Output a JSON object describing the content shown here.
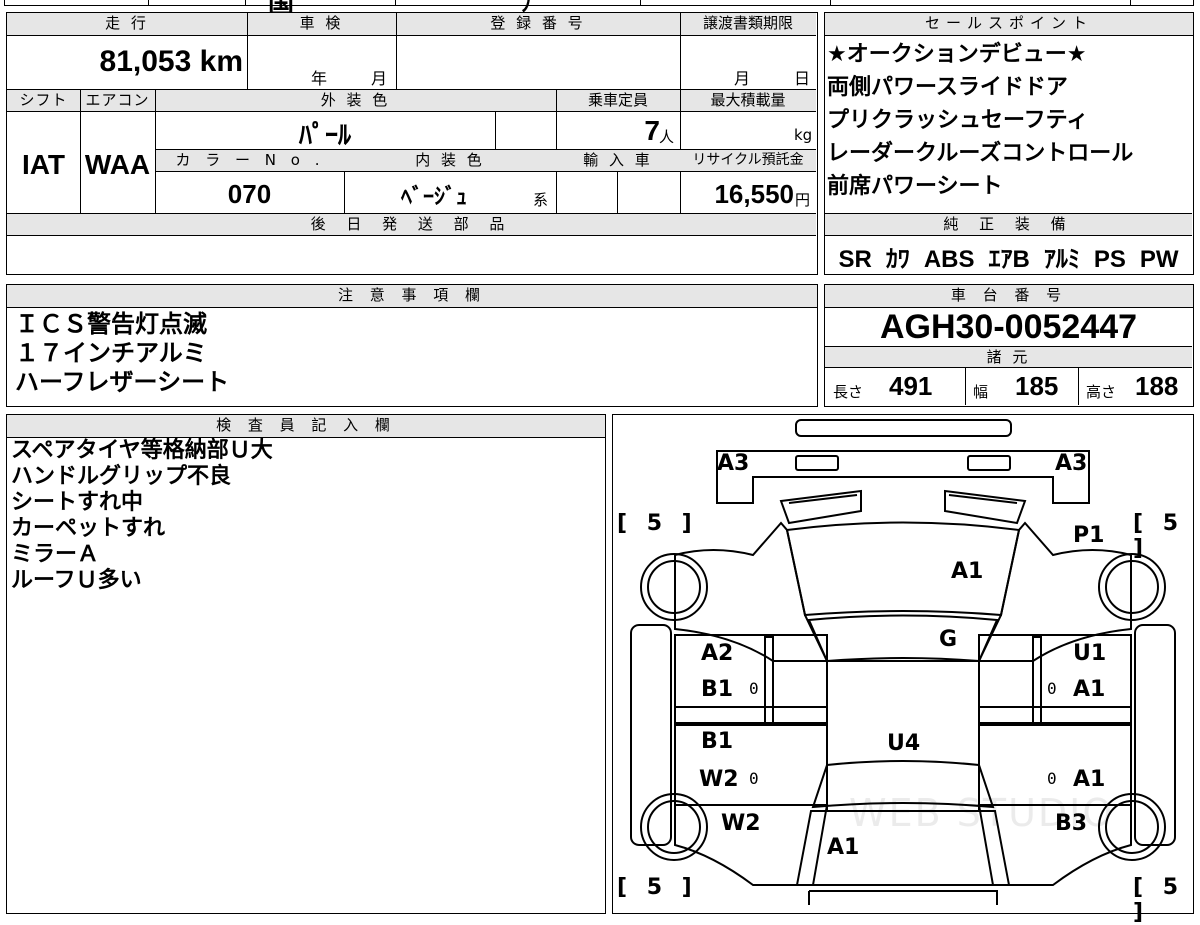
{
  "top_strip": {
    "partial_text_1": "国",
    "partial_text_2": "ﾌ"
  },
  "basic_info": {
    "mileage_label": "走 行",
    "mileage_value": "81,053 km",
    "inspection_label": "車 検",
    "inspection_year": "年",
    "inspection_month": "月",
    "registration_label": "登 録 番 号",
    "transfer_label": "譲渡書類期限",
    "transfer_month": "月",
    "transfer_day": "日",
    "shift_label": "シフト",
    "shift_value": "IAT",
    "aircon_label": "エアコン",
    "aircon_value": "WAA",
    "exterior_color_label": "外 装 色",
    "exterior_color_value": "ﾊﾟｰﾙ",
    "capacity_label": "乗車定員",
    "capacity_value": "7",
    "capacity_unit": "人",
    "max_load_label": "最大積載量",
    "max_load_unit": "kg",
    "color_no_label": "カ ラ ー N o .",
    "color_no_value": "070",
    "interior_color_label": "内 装 色",
    "interior_color_value": "ﾍﾞｰｼﾞｭ",
    "interior_color_suffix": "系",
    "import_label": "輸 入 車",
    "recycle_label": "リサイクル預託金",
    "recycle_value": "16,550",
    "recycle_unit": "円",
    "later_parts_label": "後 日 発 送 部 品"
  },
  "sales_points": {
    "header": "セールスポイント",
    "items": [
      "★オークションデビュー★",
      "両側パワースライドドア",
      "プリクラッシュセーフティ",
      "レーダークルーズコントロール",
      "前席パワーシート"
    ]
  },
  "equipment": {
    "header": "純 正 装 備",
    "items": [
      "SR",
      "ｶﾜ",
      "ABS",
      "ｴｱB",
      "ｱﾙﾐ",
      "PS",
      "PW"
    ]
  },
  "notes": {
    "header": "注 意 事 項 欄",
    "lines": [
      "ＩＣＳ警告灯点滅",
      "１７インチアルミ",
      "ハーフレザーシート"
    ]
  },
  "chassis": {
    "header": "車 台 番 号",
    "value": "AGH30-0052447"
  },
  "specs": {
    "header": "諸 元",
    "length_label": "長さ",
    "length_value": "491",
    "width_label": "幅",
    "width_value": "185",
    "height_label": "高さ",
    "height_value": "188"
  },
  "inspector": {
    "header": "検 査 員 記 入 欄",
    "lines": [
      "スペアタイヤ等格納部Ｕ大",
      "ハンドルグリップ不良",
      "シートすれ中",
      "カーペットすれ",
      "ミラーＡ",
      "ルーフＵ多い"
    ]
  },
  "diagram": {
    "marks": {
      "front_left": "A3",
      "front_right": "A3",
      "tire_fl": "[ 5 ]",
      "tire_fr": "[ 5 ]",
      "tire_rl": "[ 5 ]",
      "tire_rr": "[ 5 ]",
      "fender_fr": "P1",
      "hood": "A1",
      "windshield": "G",
      "door_fl_1": "A2",
      "door_fl_2": "B1",
      "door_fr_1": "U1",
      "door_fr_2": "A1",
      "roof": "U4",
      "door_rl_1": "B1",
      "door_rl_2": "W2",
      "door_rr": "A1",
      "quarter_rl": "W2",
      "quarter_rr": "B3",
      "rear": "A1",
      "zero": "0"
    },
    "watermark": "WEB STUDIO"
  }
}
